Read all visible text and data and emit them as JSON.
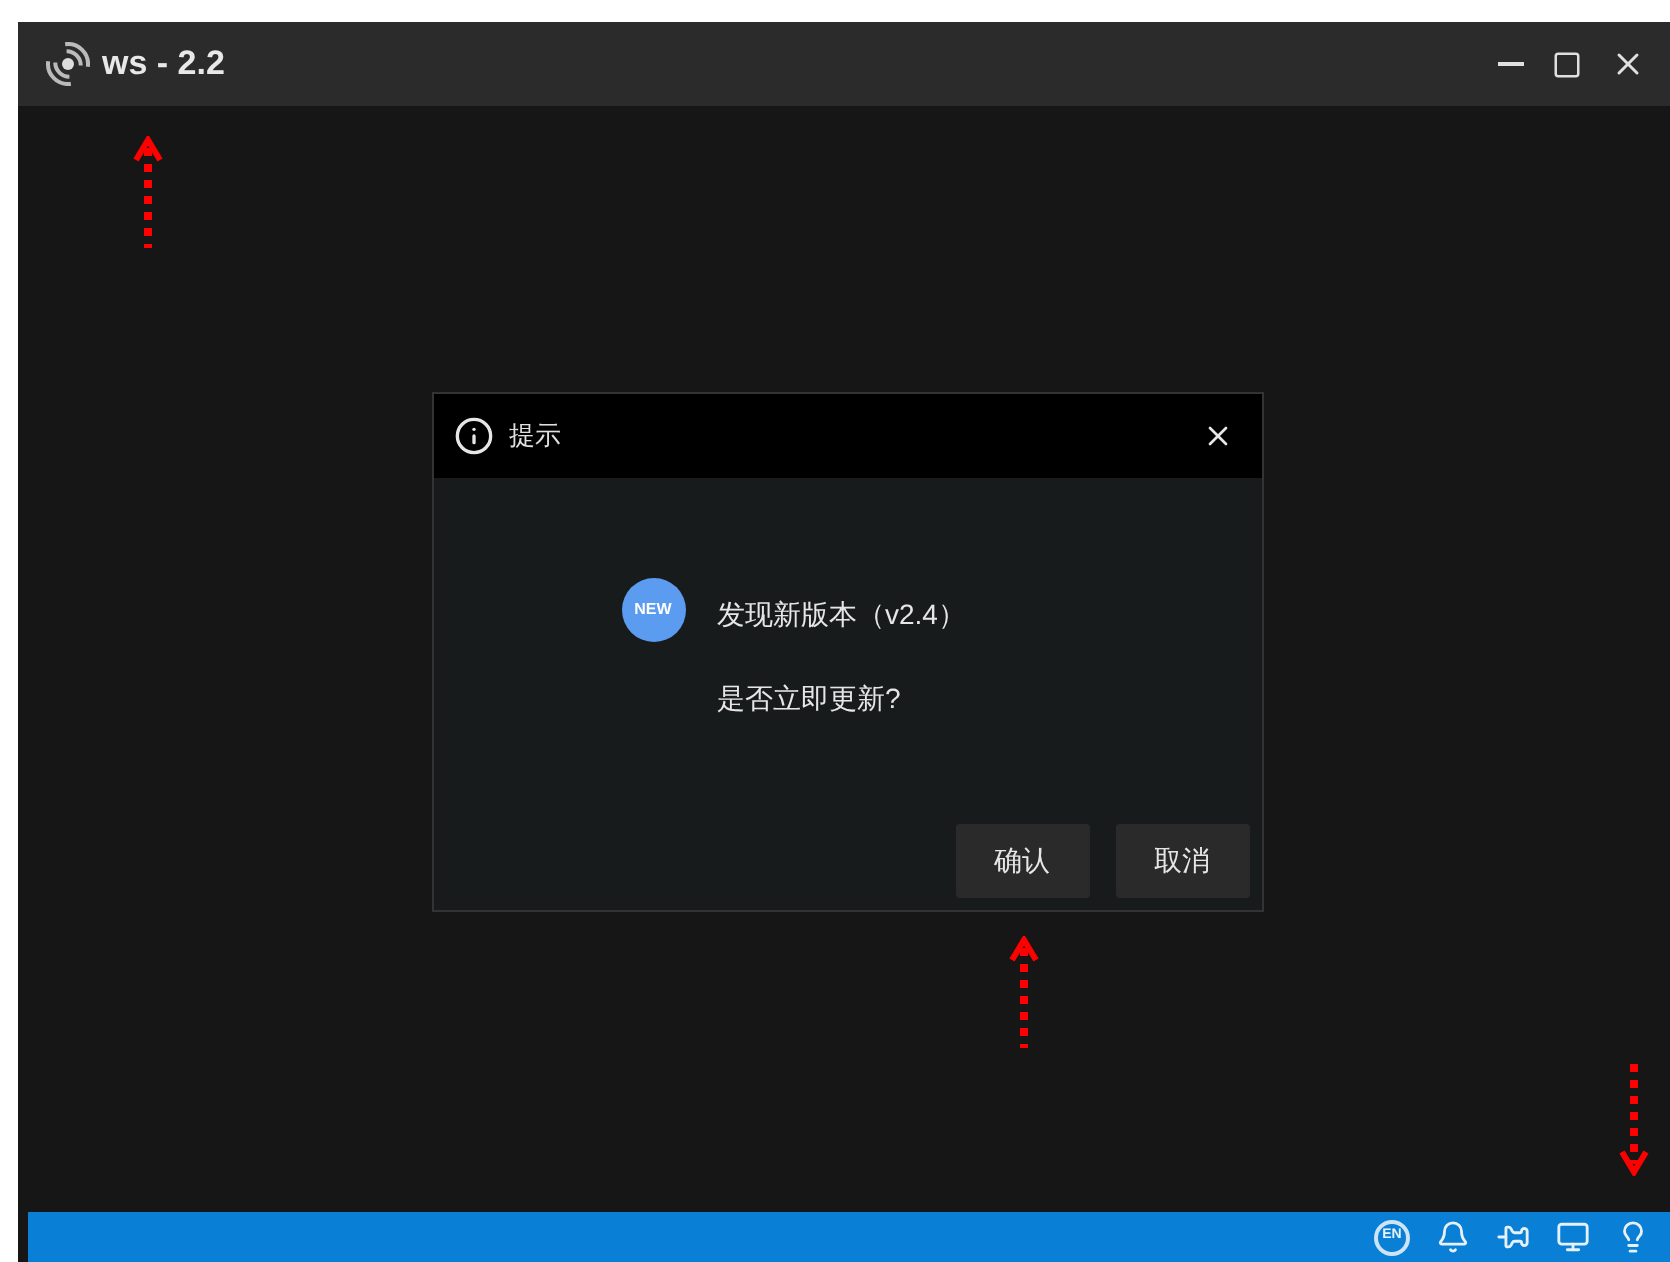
{
  "window": {
    "title": "ws - 2.2"
  },
  "dialog": {
    "title": "提示",
    "badge": "NEW",
    "message": "发现新版本（v2.4）",
    "question": "是否立即更新?",
    "buttons": [
      {
        "label": "确认"
      },
      {
        "label": "取消"
      }
    ]
  },
  "status_bar": {
    "language": "EN"
  }
}
